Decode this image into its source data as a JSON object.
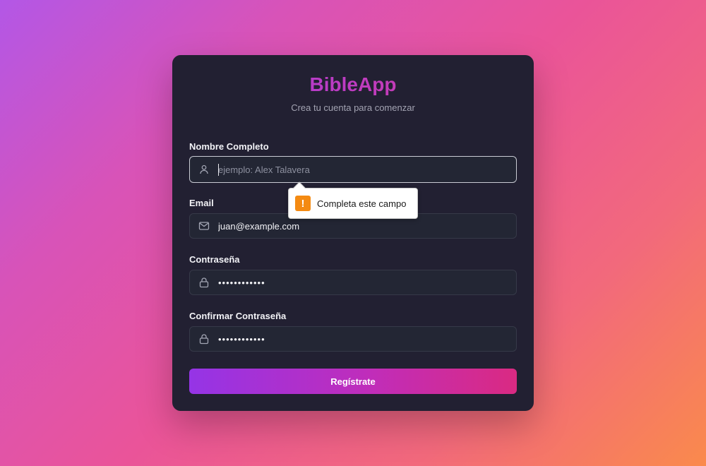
{
  "app": {
    "title": "BibleApp",
    "subtitle": "Crea tu cuenta para comenzar"
  },
  "form": {
    "fullname": {
      "label": "Nombre Completo",
      "value": "",
      "placeholder": "ejemplo: Alex Talavera"
    },
    "email": {
      "label": "Email",
      "value": "juan@example.com"
    },
    "password": {
      "label": "Contraseña",
      "value": "••••••••••••"
    },
    "confirm_password": {
      "label": "Confirmar Contraseña",
      "value": "••••••••••••"
    },
    "submit_label": "Regístrate"
  },
  "validation": {
    "message": "Completa este campo",
    "icon": "warning-icon"
  },
  "colors": {
    "brand_gradient_start": "#a83ee0",
    "brand_gradient_end": "#d33aa0",
    "card_background": "#222032",
    "warning": "#f48a12"
  },
  "icons": {
    "fullname": "user-icon",
    "email": "mail-icon",
    "password": "lock-icon",
    "confirm_password": "lock-icon"
  }
}
